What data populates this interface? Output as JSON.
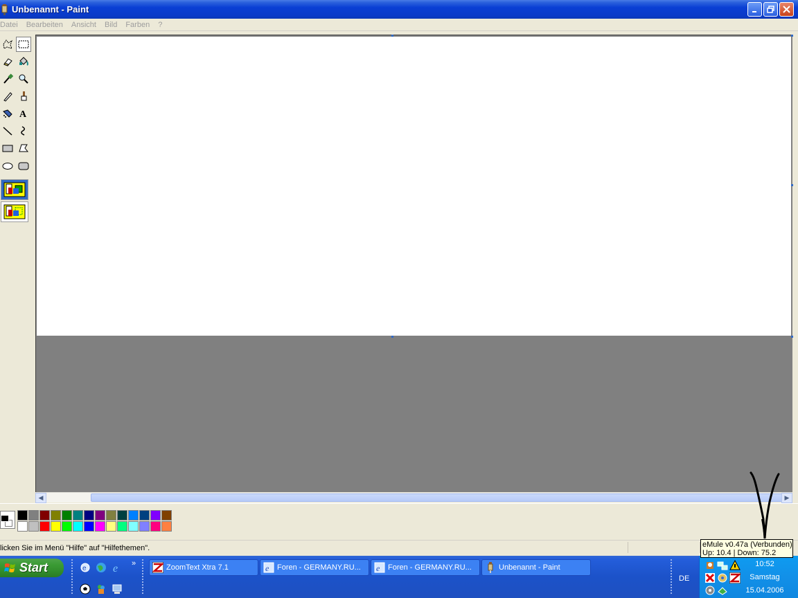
{
  "window": {
    "title": "Unbenannt - Paint"
  },
  "menu": {
    "items": [
      "Datei",
      "Bearbeiten",
      "Ansicht",
      "Bild",
      "Farben",
      "?"
    ]
  },
  "toolbox": {
    "tools": [
      "free-form-select",
      "rectangle-select",
      "eraser",
      "fill",
      "color-picker",
      "magnifier",
      "pencil",
      "brush",
      "airbrush",
      "text",
      "line",
      "curve",
      "rectangle",
      "polygon",
      "ellipse",
      "rounded-rectangle"
    ],
    "selected_tool": "rectangle-select",
    "options": [
      "opaque-selection",
      "transparent-selection"
    ]
  },
  "palette": {
    "foreground": "#000000",
    "background": "#ffffff",
    "colors_row1": [
      "#000000",
      "#808080",
      "#800000",
      "#808000",
      "#008000",
      "#008080",
      "#000080",
      "#800080",
      "#808040",
      "#004040",
      "#0080ff",
      "#004080",
      "#8000ff",
      "#804000"
    ],
    "colors_row2": [
      "#ffffff",
      "#c0c0c0",
      "#ff0000",
      "#ffff00",
      "#00ff00",
      "#00ffff",
      "#0000ff",
      "#ff00ff",
      "#ffff80",
      "#00ff80",
      "#80ffff",
      "#8080ff",
      "#ff0080",
      "#ff8040"
    ]
  },
  "statusbar": {
    "text": "licken Sie im Menü \"Hilfe\" auf \"Hilfethemen\"."
  },
  "taskbar": {
    "start_label": "Start",
    "quick_launch_more": "»",
    "tasks": [
      {
        "label": "ZoomText Xtra 7.1",
        "icon": "zoomtext-icon"
      },
      {
        "label": "Foren - GERMANY.RU...",
        "icon": "ie-icon"
      },
      {
        "label": "Foren - GERMANY.RU...",
        "icon": "ie-icon"
      },
      {
        "label": "Unbenannt - Paint",
        "icon": "paint-icon"
      }
    ],
    "language": "DE",
    "clock": {
      "time": "10:52",
      "day": "Samstag",
      "date": "15.04.2006"
    }
  },
  "tooltip": {
    "line1": "eMule v0.47a (Verbunden)",
    "line2": "Up: 10.4 | Down: 75.2"
  },
  "colors": {
    "titlebar": "#0a3fd4",
    "workspace": "#808080",
    "canvas": "#ffffff",
    "taskbar": "#245edb",
    "start_button": "#3c9c36"
  }
}
